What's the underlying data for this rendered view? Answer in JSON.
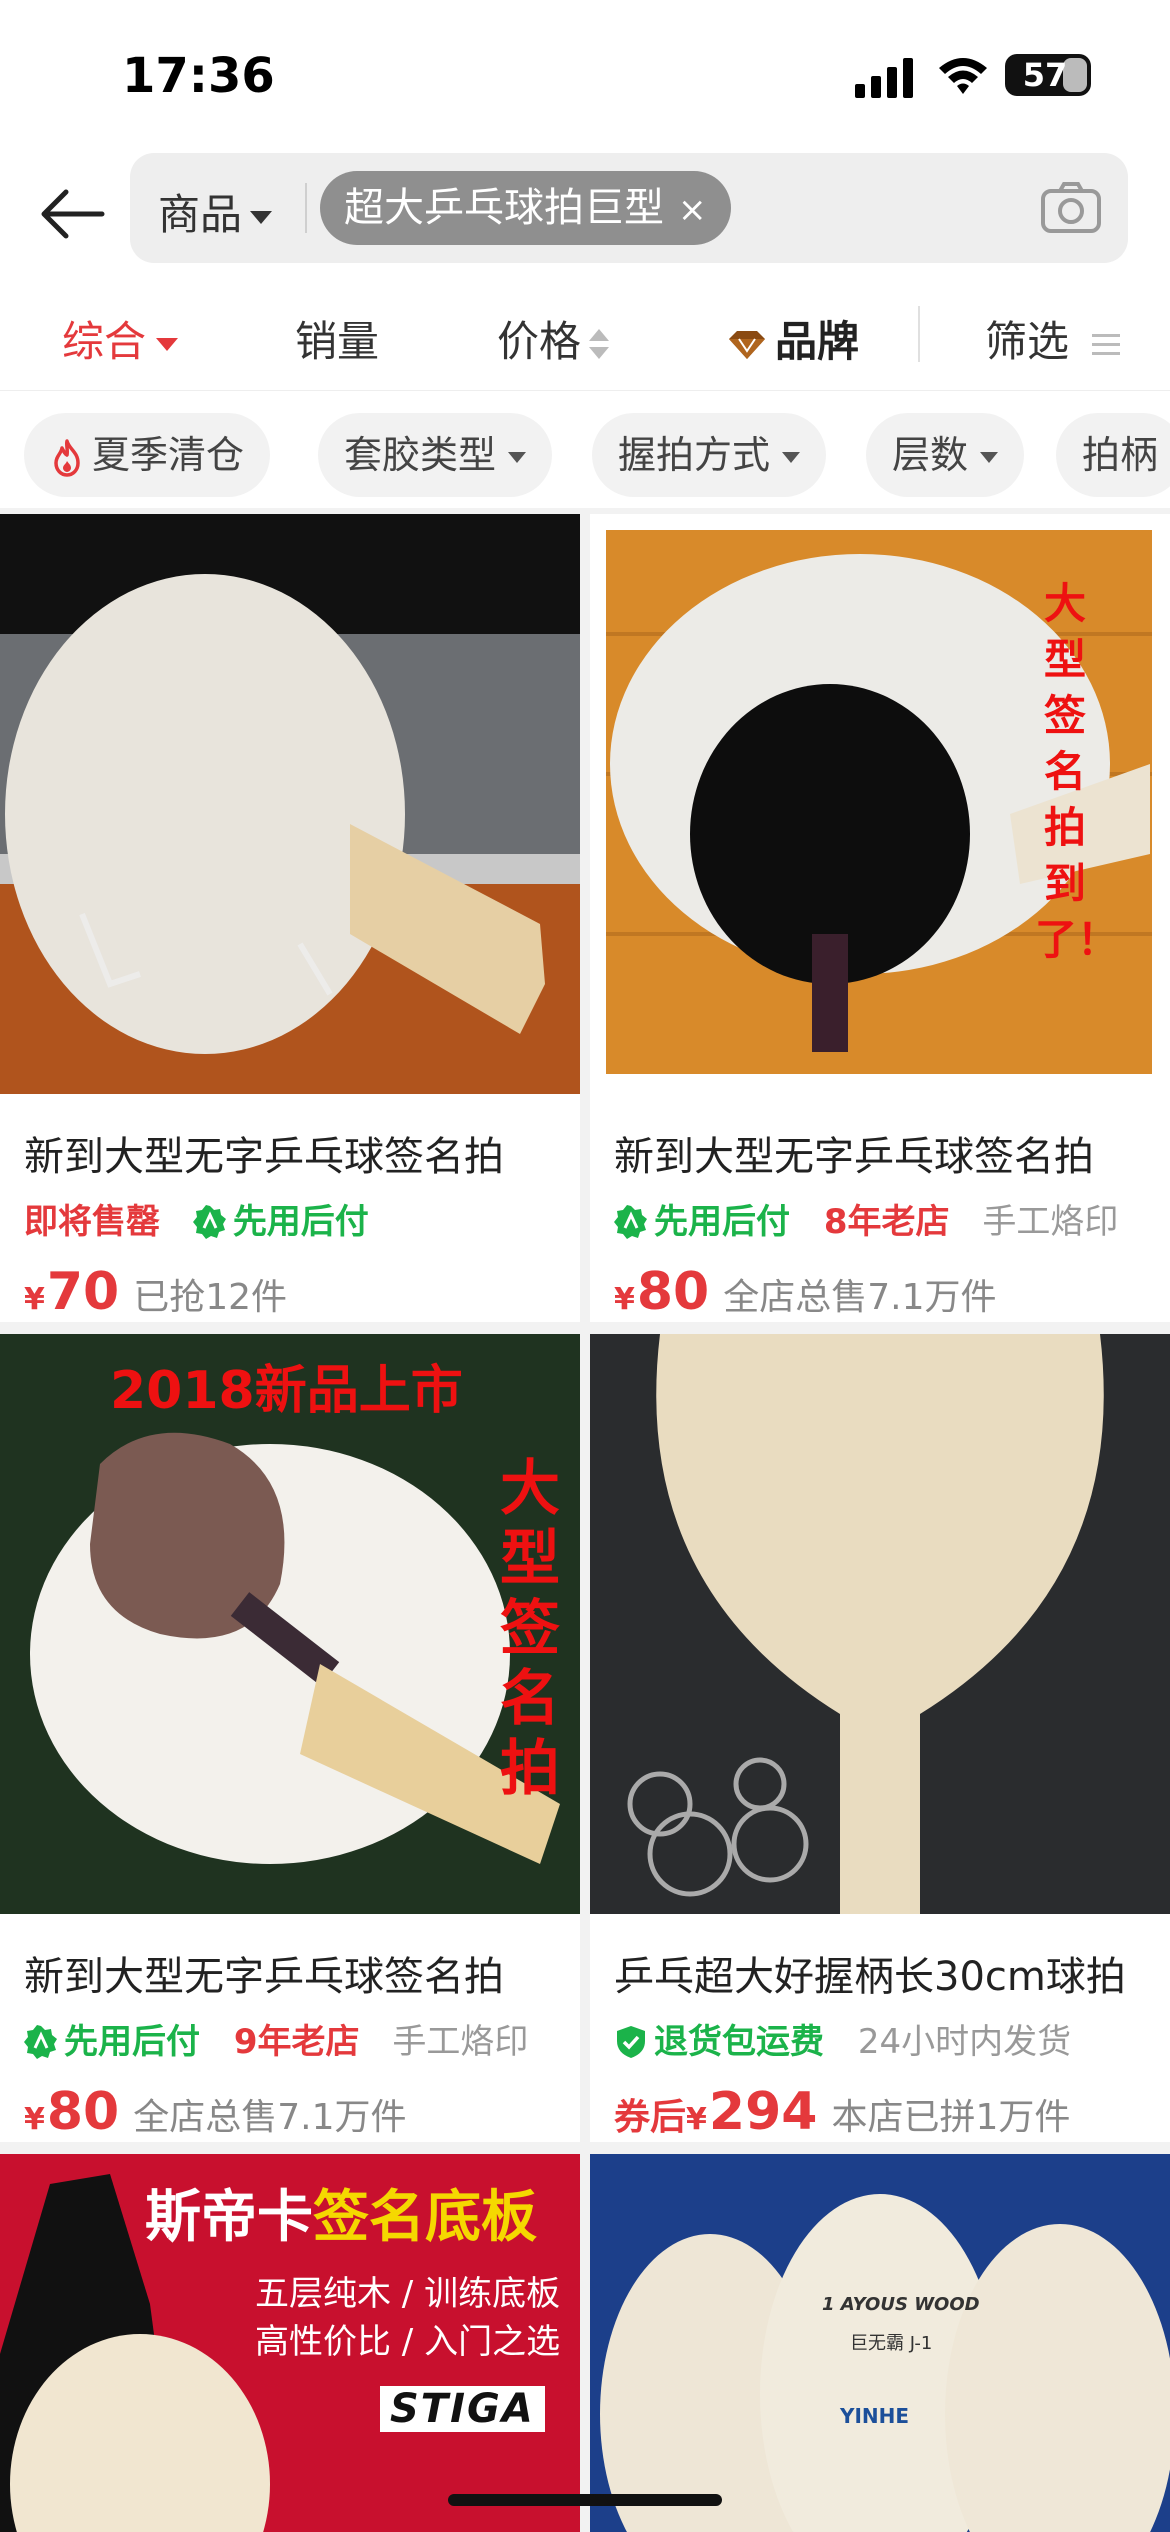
{
  "status_bar": {
    "time": "17:36",
    "battery": "57"
  },
  "search": {
    "scope": "商品",
    "query_chip": "超大乒乓球拍巨型",
    "clear_symbol": "×"
  },
  "sort_tabs": [
    {
      "label": "综合",
      "active": true
    },
    {
      "label": "销量"
    },
    {
      "label": "价格"
    },
    {
      "label": "品牌"
    },
    {
      "label": "筛选"
    }
  ],
  "filters": [
    "夏季清仓",
    "套胶类型",
    "握拍方式",
    "层数",
    "拍柄"
  ],
  "products": [
    {
      "title": "新到大型无字乒乓球签名拍",
      "tags": [
        {
          "text": "即将售罄",
          "style": "red"
        },
        {
          "text": "先用后付",
          "style": "green",
          "icon": "pay-later-icon"
        }
      ],
      "price_prefix": "",
      "currency": "¥",
      "price": "70",
      "sold": "已抢12件"
    },
    {
      "title": "新到大型无字乒乓球签名拍",
      "tags": [
        {
          "text": "先用后付",
          "style": "green",
          "icon": "pay-later-icon"
        },
        {
          "text": "8年老店",
          "style": "red"
        },
        {
          "text": "手工烙印",
          "style": "gray"
        }
      ],
      "price_prefix": "",
      "currency": "¥",
      "price": "80",
      "sold": "全店总售7.1万件",
      "image_overlay": "大型签名拍到了！"
    },
    {
      "title": "新到大型无字乒乓球签名拍",
      "tags": [
        {
          "text": "先用后付",
          "style": "green",
          "icon": "pay-later-icon"
        },
        {
          "text": "9年老店",
          "style": "red"
        },
        {
          "text": "手工烙印",
          "style": "gray"
        }
      ],
      "price_prefix": "",
      "currency": "¥",
      "price": "80",
      "sold": "全店总售7.1万件",
      "image_overlay_top": "2018新品上市",
      "image_overlay": "大型签名拍"
    },
    {
      "title": "乒乓超大好握柄长30cm球拍",
      "tags": [
        {
          "text": "退货包运费",
          "style": "green",
          "icon": "shield-check-icon"
        },
        {
          "text": "24小时内发货",
          "style": "gray"
        }
      ],
      "price_prefix": "券后",
      "currency": "¥",
      "price": "294",
      "sold": "本店已拼1万件"
    },
    {
      "image_banner_title_a": "斯帝卡",
      "image_banner_title_b": "签名底板",
      "image_banner_line1": "五层纯木 / 训练底板",
      "image_banner_line2": "高性价比 / 入门之选",
      "image_brand": "STIGA"
    },
    {
      "image_text_a": "1 AYOUS WOOD",
      "image_text_b": "巨无霸 J-1",
      "image_brand": "YINHE"
    }
  ],
  "colors": {
    "accent": "#e4393c",
    "green": "#1bb34a",
    "page_bg": "#f2f2f2"
  }
}
